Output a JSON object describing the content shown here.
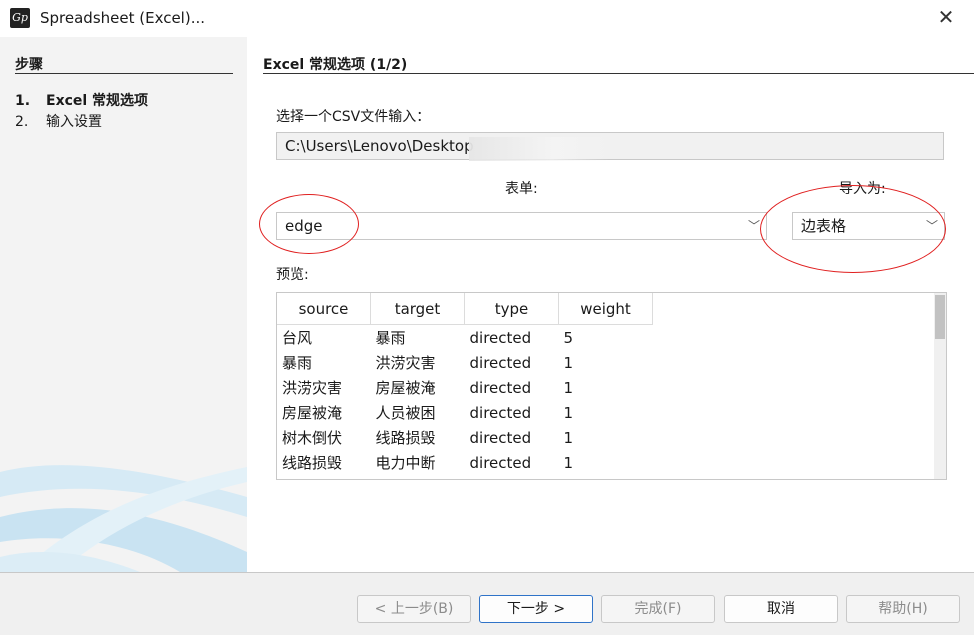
{
  "window": {
    "title": "Spreadsheet (Excel)...",
    "icon": "app-logo-icon",
    "close_glyph": "✕"
  },
  "sidebar": {
    "title": "步骤",
    "steps": [
      {
        "num": "1.",
        "label": "Excel 常规选项"
      },
      {
        "num": "2.",
        "label": "输入设置"
      }
    ]
  },
  "main": {
    "title": "Excel 常规选项 (1/2)",
    "csv_label": "选择一个CSV文件输入：",
    "csv_path": "C:\\Users\\Lenovo\\Desktop",
    "sheet_label": "表单:",
    "sheet_value": "edge",
    "import_as_label": "导入为:",
    "import_as_value": "边表格",
    "preview_label": "预览:",
    "preview": {
      "columns": [
        "source",
        "target",
        "type",
        "weight"
      ],
      "rows": [
        [
          "台风",
          "暴雨",
          "directed",
          "5"
        ],
        [
          "暴雨",
          "洪涝灾害",
          "directed",
          "1"
        ],
        [
          "洪涝灾害",
          "房屋被淹",
          "directed",
          "1"
        ],
        [
          "房屋被淹",
          "人员被困",
          "directed",
          "1"
        ],
        [
          "树木倒伏",
          "线路损毁",
          "directed",
          "1"
        ],
        [
          "线路损毁",
          "电力中断",
          "directed",
          "1"
        ]
      ]
    }
  },
  "footer": {
    "back": "< 上一步(B)",
    "next": "下一步 >",
    "finish": "完成(F)",
    "cancel": "取消",
    "help": "帮助(H)"
  },
  "colors": {
    "annotation": "#e02020",
    "primary_border": "#2f73c8",
    "sidebar_bg": "#f3f3f3"
  }
}
